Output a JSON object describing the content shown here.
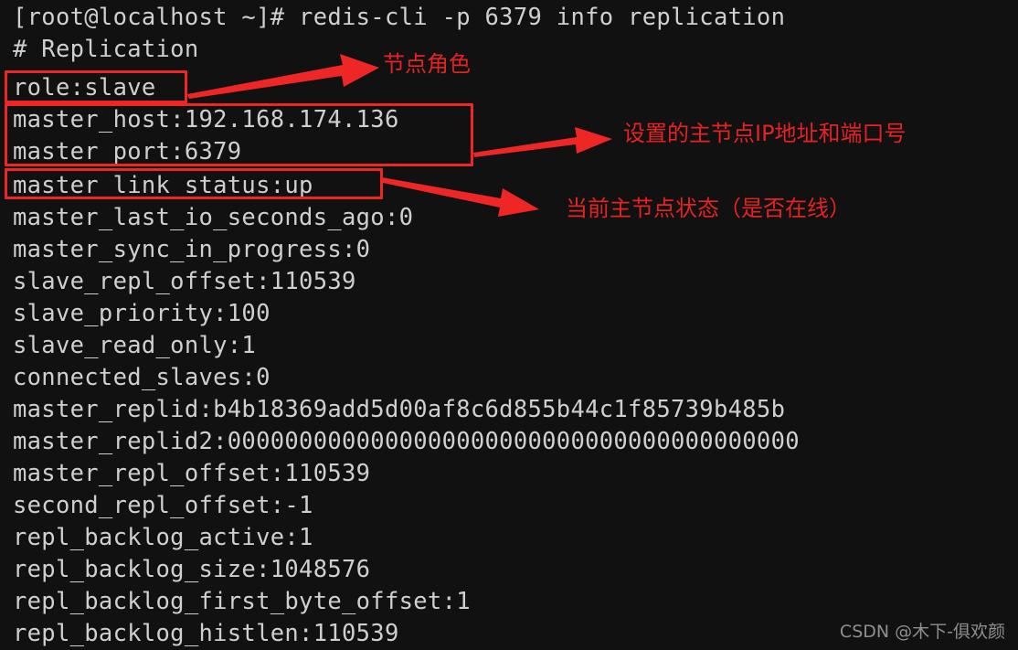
{
  "terminal": {
    "background_color": "#111112",
    "text_color": "#cfcfcf",
    "prompt_line": "[root@localhost ~]# redis-cli -p 6379 info replication",
    "lines": [
      {
        "text": "# Replication"
      },
      {
        "text": "role:slave"
      },
      {
        "text": "master_host:192.168.174.136"
      },
      {
        "text": "master_port:6379"
      },
      {
        "text": "master_link_status:up"
      },
      {
        "text": "master_last_io_seconds_ago:0"
      },
      {
        "text": "master_sync_in_progress:0"
      },
      {
        "text": "slave_repl_offset:110539"
      },
      {
        "text": "slave_priority:100"
      },
      {
        "text": "slave_read_only:1"
      },
      {
        "text": "connected_slaves:0"
      },
      {
        "text": "master_replid:b4b18369add5d00af8c6d855b44c1f85739b485b"
      },
      {
        "text": "master_replid2:0000000000000000000000000000000000000000"
      },
      {
        "text": "master_repl_offset:110539"
      },
      {
        "text": "second_repl_offset:-1"
      },
      {
        "text": "repl_backlog_active:1"
      },
      {
        "text": "repl_backlog_size:1048576"
      },
      {
        "text": "repl_backlog_first_byte_offset:1"
      },
      {
        "text": "repl_backlog_histlen:110539"
      }
    ]
  },
  "annotations": {
    "color": "#e62222",
    "items": [
      {
        "label": "节点角色",
        "target_line": "role:slave"
      },
      {
        "label": "设置的主节点IP地址和端口号",
        "target_line": "master_host:192.168.174.136 / master_port:6379"
      },
      {
        "label": "当前主节点状态（是否在线）",
        "target_line": "master_link_status:up"
      }
    ]
  },
  "watermark": {
    "text": "CSDN @木下-俱欢颜"
  }
}
